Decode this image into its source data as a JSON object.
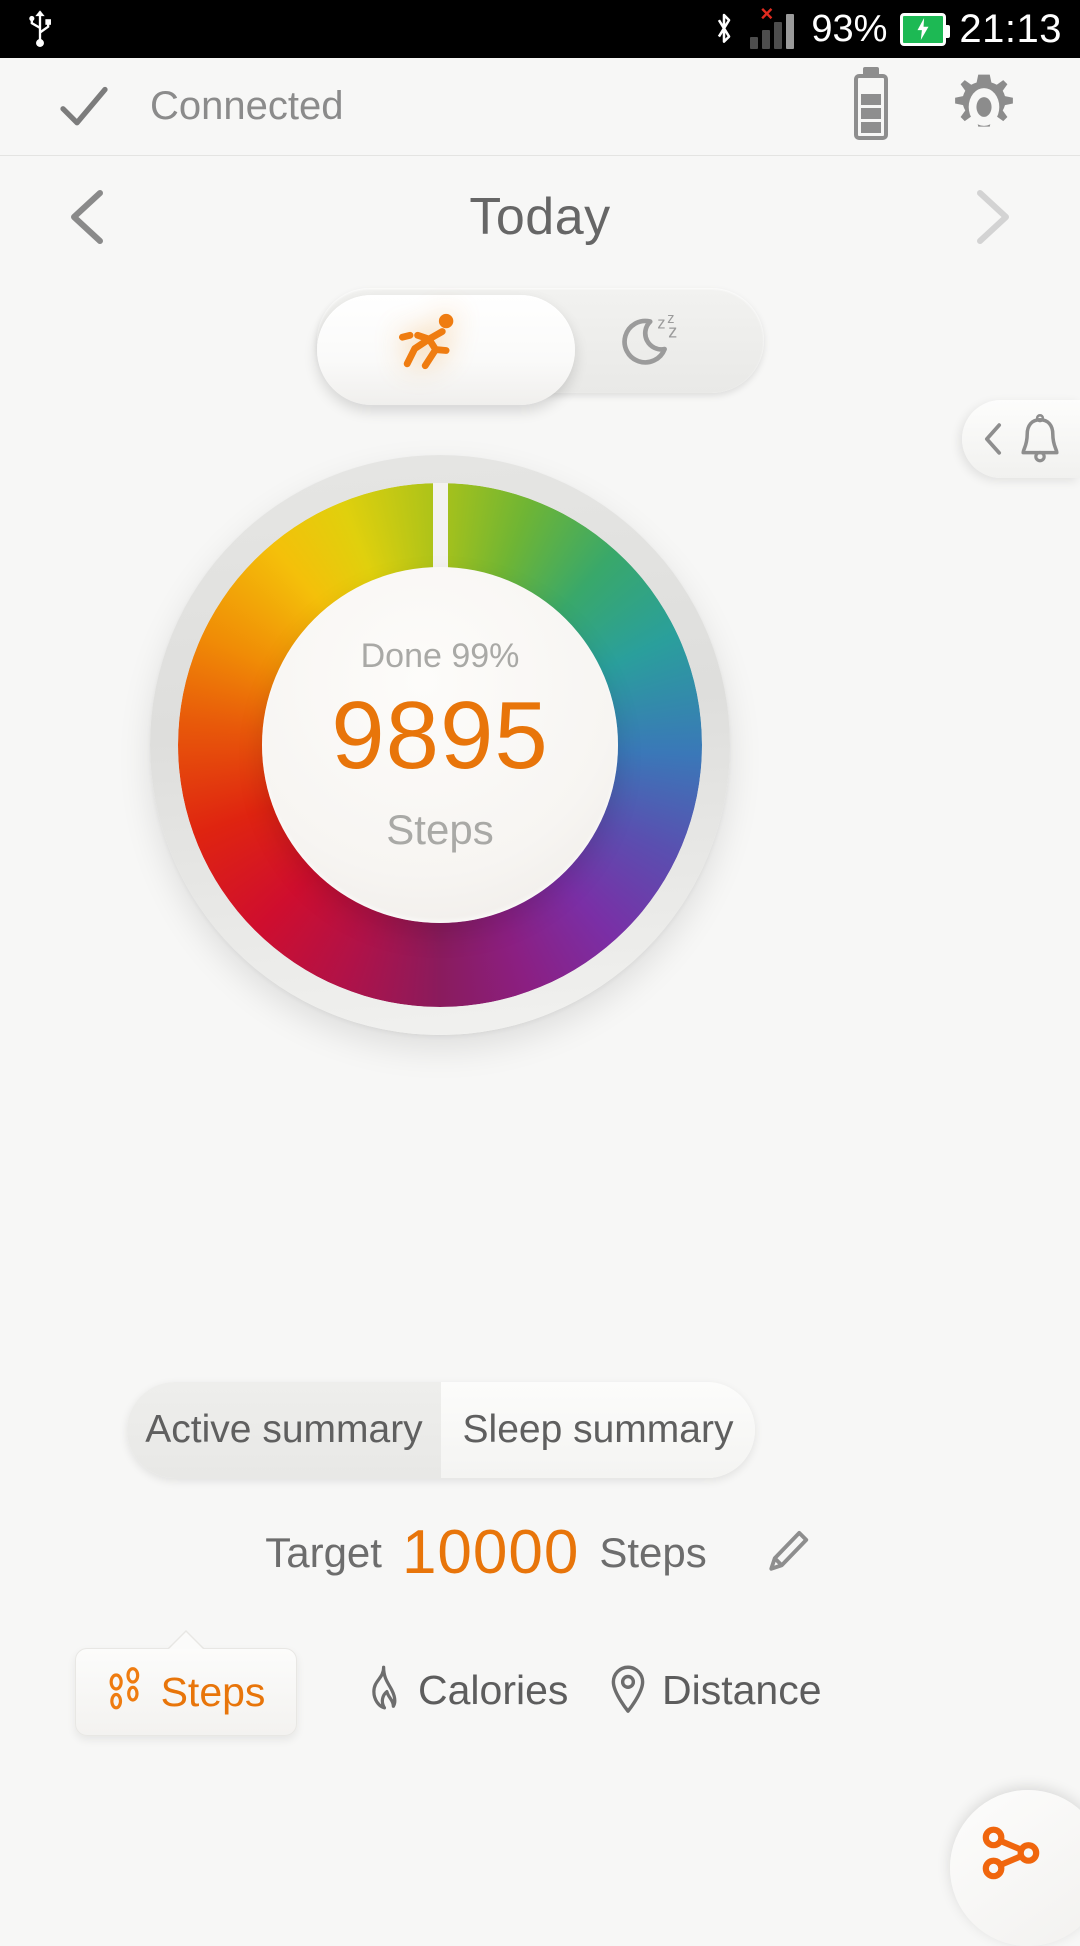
{
  "status_bar": {
    "usb_icon": "usb-icon",
    "bluetooth_icon": "bluetooth-icon",
    "signal_icon": "signal-bars-icon",
    "signal_error": "×",
    "battery_percent": "93%",
    "battery_icon": "battery-charging-icon",
    "time": "21:13"
  },
  "app_bar": {
    "check_icon": "check-icon",
    "connection_status": "Connected",
    "device_battery_icon": "device-battery-icon",
    "settings_icon": "gear-icon"
  },
  "date_nav": {
    "prev_icon": "chevron-left-icon",
    "title": "Today",
    "next_icon": "chevron-right-icon"
  },
  "mode_toggle": {
    "active_mode": "activity",
    "activity_icon": "running-person-icon",
    "sleep_icon": "moon-sleep-icon"
  },
  "notification_tab": {
    "chevron_icon": "chevron-left-icon",
    "bell_icon": "bell-icon"
  },
  "ring": {
    "done_label": "Done 99%",
    "value": "9895",
    "unit": "Steps",
    "accent_color": "#e8750a",
    "muted_color": "#a9a9a6",
    "progress_percent": 99
  },
  "summary_tabs": [
    {
      "label": "Active summary",
      "selected": true
    },
    {
      "label": "Sleep summary",
      "selected": false
    }
  ],
  "target": {
    "prefix": "Target",
    "value": "10000",
    "suffix": "Steps",
    "edit_icon": "pencil-icon",
    "accent_color": "#e8750a"
  },
  "metric_tabs": [
    {
      "label": "Steps",
      "icon": "footprints-icon",
      "selected": true
    },
    {
      "label": "Calories",
      "icon": "flame-icon",
      "selected": false
    },
    {
      "label": "Distance",
      "icon": "map-pin-icon",
      "selected": false
    }
  ],
  "fab": {
    "icon": "share-icon",
    "color": "#f0660d"
  }
}
